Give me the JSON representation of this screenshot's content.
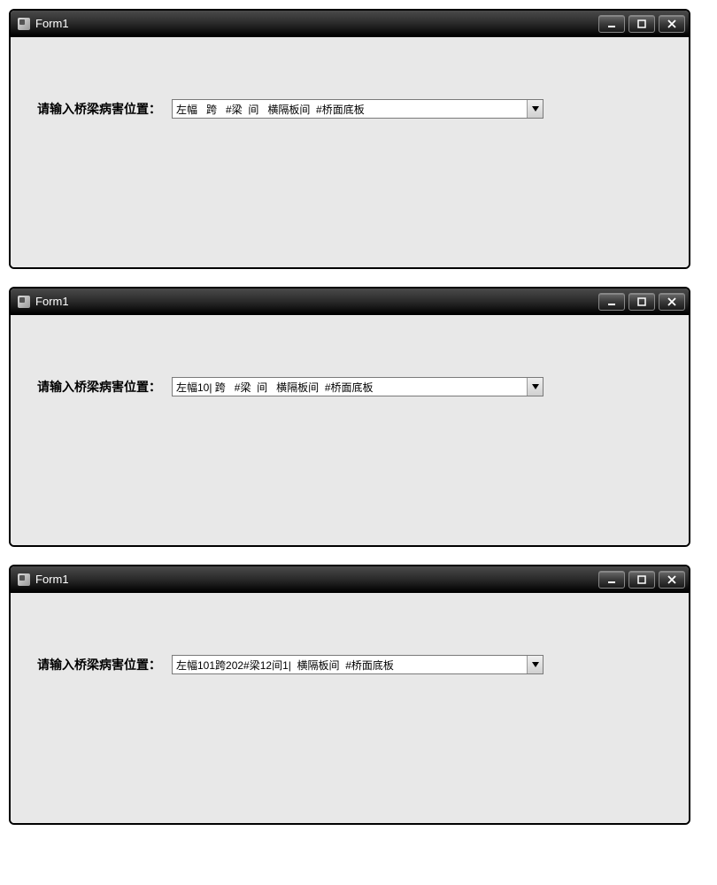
{
  "windows": [
    {
      "title": "Form1",
      "label": "请输入桥梁病害位置：",
      "input_value": "左幅   跨   #梁  间   横隔板间  #桥面底板"
    },
    {
      "title": "Form1",
      "label": "请输入桥梁病害位置：",
      "input_value": "左幅10| 跨   #梁  间   横隔板间  #桥面底板"
    },
    {
      "title": "Form1",
      "label": "请输入桥梁病害位置：",
      "input_value": "左幅101跨202#梁12间1|  横隔板间  #桥面底板"
    }
  ]
}
